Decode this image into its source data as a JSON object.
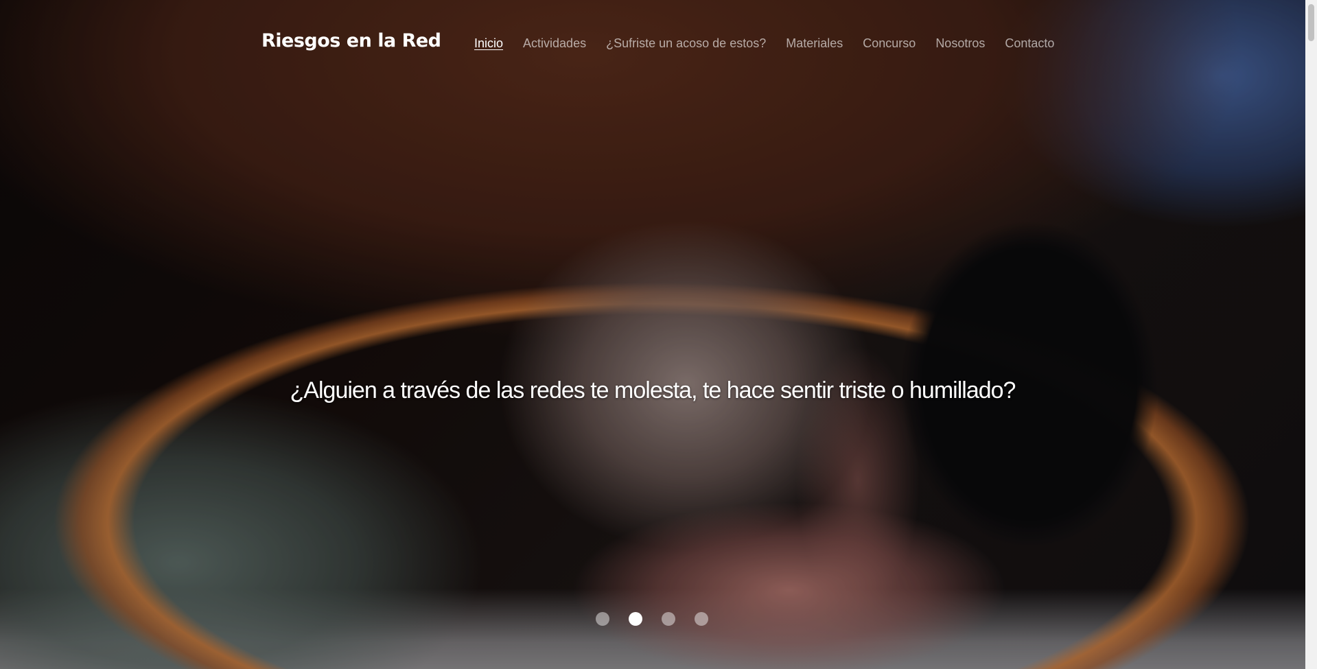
{
  "brand": {
    "title": "Riesgos en la Red"
  },
  "nav": {
    "items": [
      {
        "label": "Inicio",
        "active": true
      },
      {
        "label": "Actividades",
        "active": false
      },
      {
        "label": "¿Sufriste un acoso de estos?",
        "active": false
      },
      {
        "label": "Materiales",
        "active": false
      },
      {
        "label": "Concurso",
        "active": false
      },
      {
        "label": "Nosotros",
        "active": false
      },
      {
        "label": "Contacto",
        "active": false
      }
    ]
  },
  "hero": {
    "caption": "¿Alguien a través de las redes te molesta, te hace sentir triste o humillado?",
    "background_image": "teen-under-blanket-looking-at-phone",
    "slides_total": 4,
    "active_slide": 2
  },
  "colors": {
    "text_primary": "#ffffff",
    "text_muted": "rgba(255,255,255,0.62)",
    "indicator_active": "#ffffff",
    "indicator_inactive": "rgba(255,255,255,0.45)"
  }
}
